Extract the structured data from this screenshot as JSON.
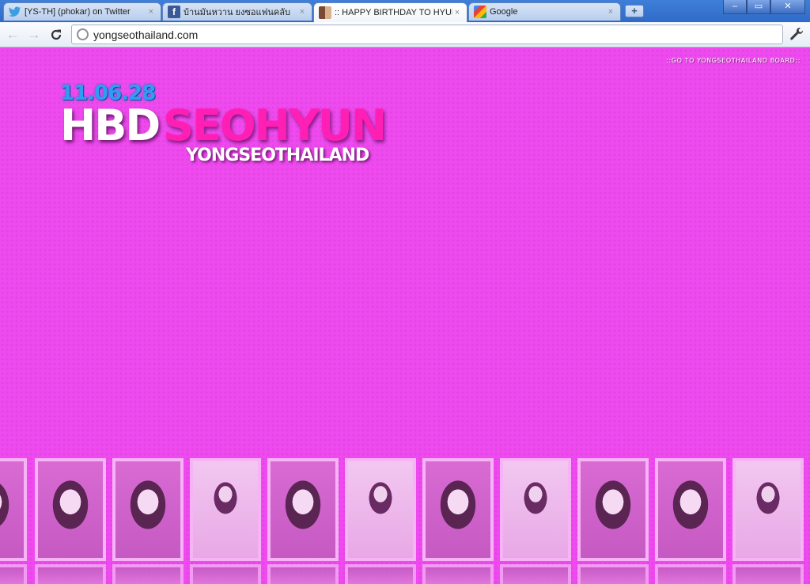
{
  "browser": {
    "tabs": [
      {
        "title": "[YS-TH] (phokar) on Twitter",
        "icon": "twitter-bird-icon",
        "active": false
      },
      {
        "title": "บ้านมันหวาน ยงซอแฟนคลับ",
        "icon": "facebook-icon",
        "active": false
      },
      {
        "title": ":: HAPPY BIRTHDAY TO HYUN",
        "icon": "girls-favicon-icon",
        "active": true
      },
      {
        "title": "Google",
        "icon": "google-icon",
        "active": false
      }
    ],
    "tab_close_glyph": "×",
    "newtab_glyph": "+",
    "window_controls": [
      "–",
      "▭",
      "✕"
    ],
    "nav": {
      "back": "←",
      "forward": "→",
      "reload": "C"
    },
    "url": "yongseothailand.com",
    "wrench_glyph": "🔧"
  },
  "page": {
    "board_link": "::GO TO YONGSEOTHAILAND BOARD::",
    "date": "11.06.28",
    "hbd": "HBD",
    "name": "SEOHYUN",
    "site": "YONGSEOTHAILAND"
  },
  "colors": {
    "background": "#ef4aef",
    "name_pink": "#ff1fb4",
    "date_blue": "#2f9df5"
  }
}
